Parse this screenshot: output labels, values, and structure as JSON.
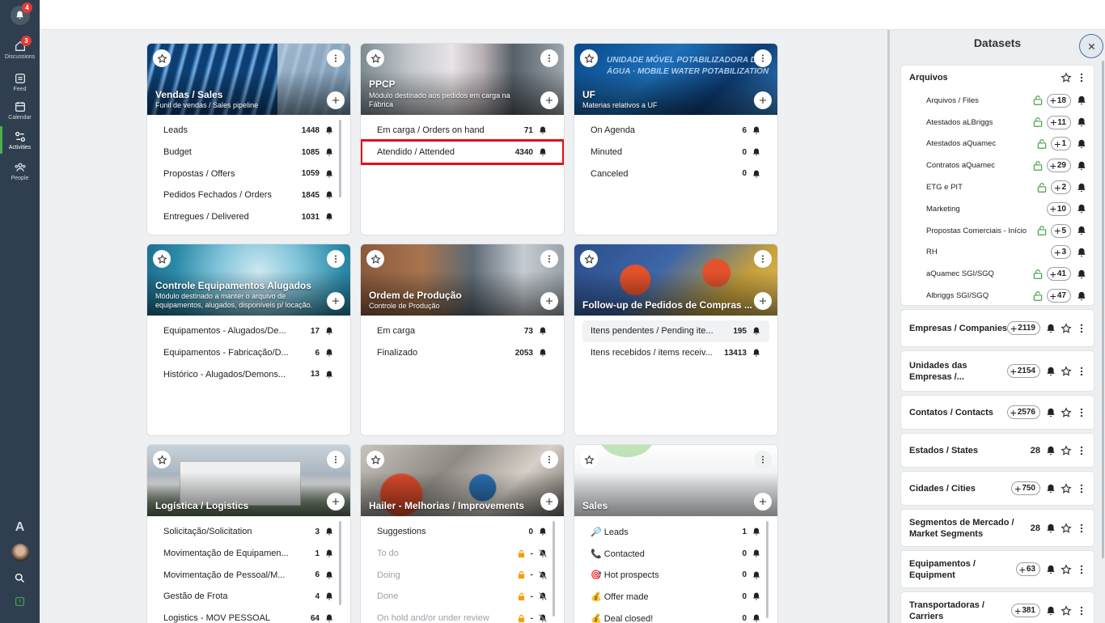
{
  "sidebar": {
    "notification_count": "4",
    "items": [
      {
        "label": "Discussions",
        "badge": "3"
      },
      {
        "label": "Feed"
      },
      {
        "label": "Calendar"
      },
      {
        "label": "Activities"
      },
      {
        "label": "People"
      }
    ],
    "logo_letter": "A"
  },
  "cards": [
    {
      "title": "Vendas / Sales",
      "subtitle": "Funil de vendas / Sales pipeline",
      "rows": [
        {
          "label": "Leads",
          "count": "1448"
        },
        {
          "label": "Budget",
          "count": "1085"
        },
        {
          "label": "Propostas / Offers",
          "count": "1059"
        },
        {
          "label": "Pedidos Fechados / Orders",
          "count": "1845"
        },
        {
          "label": "Entregues / Delivered",
          "count": "1031"
        }
      ]
    },
    {
      "title": "PPCP",
      "subtitle": "Módulo destinado aos pedidos em carga na Fábrica",
      "rows": [
        {
          "label": "Em carga / Orders on hand",
          "count": "71"
        },
        {
          "label": "Atendido / Attended",
          "count": "4340"
        }
      ]
    },
    {
      "title": "UF",
      "subtitle": "Materias relativos a UF",
      "image_text": "UNIDADE MÓVEL POTABILIZADORA DE ÁGUA · MOBILE WATER POTABILIZATION",
      "rows": [
        {
          "label": "On Agenda",
          "count": "6"
        },
        {
          "label": "Minuted",
          "count": "0"
        },
        {
          "label": "Canceled",
          "count": "0"
        }
      ]
    },
    {
      "title": "Controle Equipamentos Alugados",
      "subtitle": "Módulo destinado a manter o arquivo de equipamentos, alugados, disponíveis p/ locação.",
      "rows": [
        {
          "label": "Equipamentos - Alugados/De...",
          "count": "17"
        },
        {
          "label": "Equipamentos - Fabricação/D...",
          "count": "6"
        },
        {
          "label": "Histórico - Alugados/Demons...",
          "count": "13"
        }
      ]
    },
    {
      "title": "Ordem de Produção",
      "subtitle": "Controle de Produção",
      "rows": [
        {
          "label": "Em carga",
          "count": "73"
        },
        {
          "label": "Finalizado",
          "count": "2053"
        }
      ]
    },
    {
      "title": "Follow-up de Pedidos de Compras ...",
      "subtitle": "",
      "rows": [
        {
          "label": "Itens pendentes / Pending ite...",
          "count": "195"
        },
        {
          "label": "Itens recebidos / items receiv...",
          "count": "13413"
        }
      ]
    },
    {
      "title": "Logística / Logistics",
      "subtitle": "",
      "rows": [
        {
          "label": "Solicitação/Solicitation",
          "count": "3"
        },
        {
          "label": "Movimentação de Equipamen...",
          "count": "1"
        },
        {
          "label": "Movimentação de Pessoal/M...",
          "count": "6"
        },
        {
          "label": "Gestão de Frota",
          "count": "4"
        },
        {
          "label": "Logistics - MOV PESSOAL",
          "count": "64"
        }
      ]
    },
    {
      "title": "Hailer - Melhorias / Improvements",
      "subtitle": "",
      "rows": [
        {
          "label": "Suggestions",
          "count": "0"
        },
        {
          "label": "To do",
          "count": "-"
        },
        {
          "label": "Doing",
          "count": "-"
        },
        {
          "label": "Done",
          "count": "-"
        },
        {
          "label": "On hold and/or under review",
          "count": "-"
        }
      ]
    },
    {
      "title": "Sales",
      "subtitle": "",
      "rows": [
        {
          "label": "🔎 Leads",
          "count": "1"
        },
        {
          "label": "📞 Contacted",
          "count": "0"
        },
        {
          "label": "🎯 Hot prospects",
          "count": "0"
        },
        {
          "label": "💰 Offer made",
          "count": "0"
        },
        {
          "label": "💰 Deal closed!",
          "count": "0"
        }
      ]
    }
  ],
  "panel": {
    "title": "Datasets",
    "arquivos": {
      "title": "Arquivos",
      "items": [
        {
          "name": "Arquivos / Files",
          "count": "18"
        },
        {
          "name": "Atestados aLBriggs",
          "count": "11"
        },
        {
          "name": "Atestados aQuamec",
          "count": "1"
        },
        {
          "name": "Contratos aQuamec",
          "count": "29"
        },
        {
          "name": "ETG e PIT",
          "count": "2"
        },
        {
          "name": "Marketing",
          "count": "10"
        },
        {
          "name": "Propostas Comerciais - Início",
          "count": "5"
        },
        {
          "name": "RH",
          "count": "3"
        },
        {
          "name": "aQuamec SGI/SGQ",
          "count": "41"
        },
        {
          "name": "Albriggs SGI/SGQ",
          "count": "47"
        }
      ]
    },
    "datasets": [
      {
        "name": "Empresas / Companies",
        "count": "2119"
      },
      {
        "name": "Unidades das Empresas /...",
        "count": "2154"
      },
      {
        "name": "Contatos / Contacts",
        "count": "2576"
      },
      {
        "name": "Estados / States",
        "count": "28"
      },
      {
        "name": "Cidades / Cities",
        "count": "750"
      },
      {
        "name": "Segmentos de Mercado / Market Segments",
        "count": "28"
      },
      {
        "name": "Equipamentos / Equipment",
        "count": "63"
      },
      {
        "name": "Transportadoras / Carriers",
        "count": "381"
      }
    ]
  }
}
